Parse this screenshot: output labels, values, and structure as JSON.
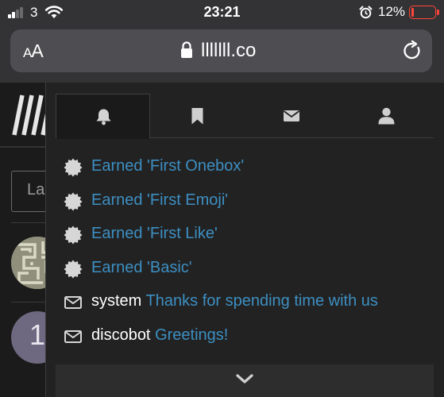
{
  "status_bar": {
    "carrier": "3",
    "time": "23:21",
    "battery": "12%",
    "battery_level": 0.12,
    "signal_bars": 2,
    "icons": [
      "signal-icon",
      "wifi-icon",
      "alarm-icon",
      "battery-icon"
    ]
  },
  "browser": {
    "text_size_label": "AA",
    "url": "lllllll.co",
    "icons": [
      "lock-icon",
      "reload-icon"
    ]
  },
  "page": {
    "input_text": "La",
    "avatar_letter": "1"
  },
  "menu": {
    "tabs": [
      {
        "name": "notifications",
        "icon": "bell-icon",
        "active": true
      },
      {
        "name": "bookmarks",
        "icon": "bookmark-icon",
        "active": false
      },
      {
        "name": "messages",
        "icon": "envelope-icon",
        "active": false
      },
      {
        "name": "profile",
        "icon": "user-icon",
        "active": false
      }
    ],
    "notifications": [
      {
        "icon": "badge-icon",
        "user": "",
        "text": "Earned 'First Onebox'"
      },
      {
        "icon": "badge-icon",
        "user": "",
        "text": "Earned 'First Emoji'"
      },
      {
        "icon": "badge-icon",
        "user": "",
        "text": "Earned 'First Like'"
      },
      {
        "icon": "badge-icon",
        "user": "",
        "text": "Earned 'Basic'"
      },
      {
        "icon": "envelope-icon",
        "user": "system",
        "text": "Thanks for spending time with us"
      },
      {
        "icon": "envelope-icon",
        "user": "discobot",
        "text": "Greetings!"
      }
    ],
    "more_icon": "chevron-down-icon"
  },
  "colors": {
    "link": "#3d8fc2",
    "battery_low": "#ff453a",
    "panel": "#222222"
  }
}
